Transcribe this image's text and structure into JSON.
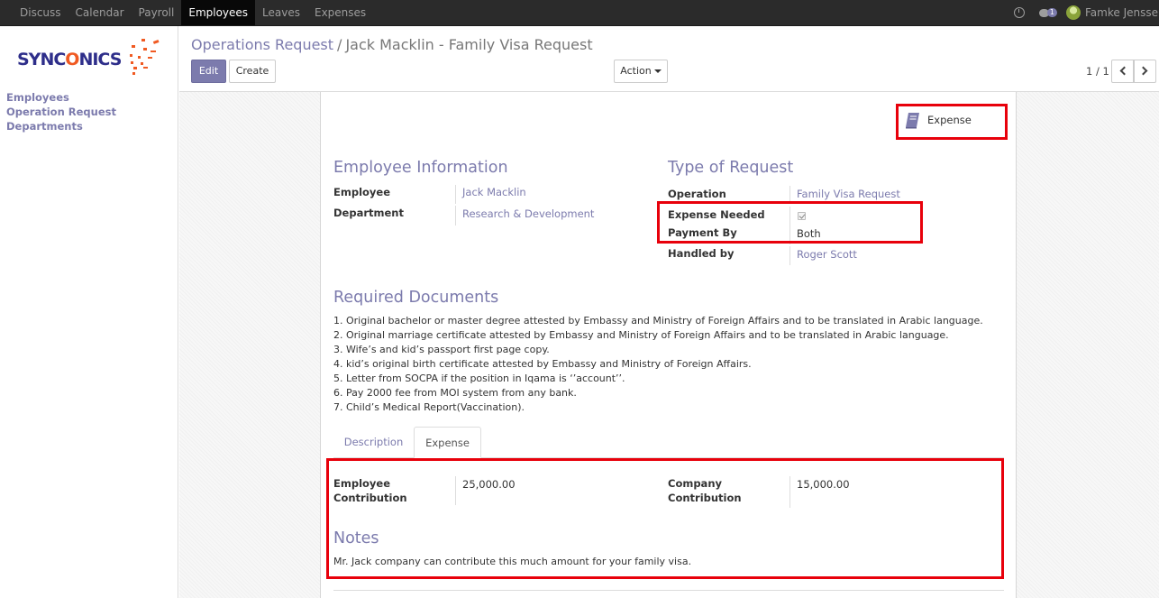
{
  "topbar": {
    "menu": [
      "Discuss",
      "Calendar",
      "Payroll",
      "Employees",
      "Leaves",
      "Expenses"
    ],
    "active": "Employees",
    "chat_count": "1",
    "user": "Famke Jenssen"
  },
  "sidebar": {
    "logo": {
      "part1": "SYNC",
      "part2": "O",
      "part3": "NICS"
    },
    "links": [
      "Employees",
      "Operation Request",
      "Departments"
    ]
  },
  "control": {
    "breadcrumb_parent": "Operations Request",
    "breadcrumb_sep": "/",
    "breadcrumb_current": "Jack Macklin - Family Visa Request",
    "edit_label": "Edit",
    "create_label": "Create",
    "action_label": "Action",
    "pager": "1 / 1"
  },
  "form": {
    "smart_button": "Expense",
    "employee_info": {
      "title": "Employee Information",
      "employee_label": "Employee",
      "employee_value": "Jack Macklin",
      "department_label": "Department",
      "department_value": "Research & Development"
    },
    "request_type": {
      "title": "Type of Request",
      "operation_label": "Operation",
      "operation_value": "Family Visa Request",
      "expense_needed_label": "Expense Needed",
      "expense_needed_value": true,
      "payment_by_label": "Payment By",
      "payment_by_value": "Both",
      "handled_by_label": "Handled by",
      "handled_by_value": "Roger Scott"
    },
    "required_docs": {
      "title": "Required Documents",
      "items": [
        "1. Original bachelor or master degree attested by Embassy and Ministry of Foreign Affairs and to be translated in Arabic language.",
        "2. Original marriage certificate attested by Embassy and Ministry of Foreign Affairs and to be translated in Arabic language.",
        "3. Wife’s and kid’s passport first page copy.",
        "4. kid’s original birth certificate attested by Embassy and Ministry of Foreign Affairs.",
        "5. Letter from SOCPA if the position in Iqama is ‘’account’’.",
        "6. Pay 2000 fee from MOI system from any bank.",
        "7. Child’s Medical Report(Vaccination)."
      ]
    },
    "tabs": [
      "Description",
      "Expense"
    ],
    "active_tab": "Expense",
    "expense": {
      "employee_contribution_label_1": "Employee",
      "employee_contribution_label_2": "Contribution",
      "employee_contribution_value": "25,000.00",
      "company_contribution_label_1": "Company",
      "company_contribution_label_2": "Contribution",
      "company_contribution_value": "15,000.00",
      "notes_title": "Notes",
      "notes_text": "Mr. Jack company can contribute this much amount for your family visa."
    }
  },
  "colors": {
    "accent": "#7c7bad",
    "topbar": "#2b2b2b",
    "highlight": "#e8000b",
    "logo_blue": "#2e2e8a",
    "logo_orange": "#f05a22"
  }
}
